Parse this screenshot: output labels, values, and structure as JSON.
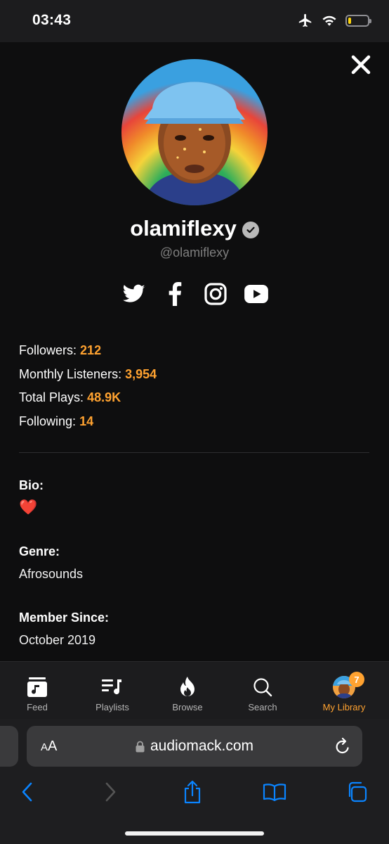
{
  "status_bar": {
    "time": "03:43",
    "icons": [
      "airplane-icon",
      "wifi-icon",
      "battery-icon"
    ],
    "battery_level": 0.15
  },
  "profile": {
    "name": "olamiflexy",
    "handle": "@olamiflexy",
    "verified": true,
    "social_icons": [
      "twitter-icon",
      "facebook-icon",
      "instagram-icon",
      "youtube-icon"
    ]
  },
  "stats": {
    "followers_label": "Followers:",
    "followers_value": "212",
    "monthly_label": "Monthly Listeners:",
    "monthly_value": "3,954",
    "plays_label": "Total Plays:",
    "plays_value": "48.9K",
    "following_label": "Following:",
    "following_value": "14"
  },
  "info": {
    "bio_label": "Bio:",
    "bio_value": "❤️",
    "genre_label": "Genre:",
    "genre_value": "Afrosounds",
    "member_label": "Member Since:",
    "member_value": "October 2019"
  },
  "tabs": [
    {
      "label": "Feed",
      "icon": "feed-icon"
    },
    {
      "label": "Playlists",
      "icon": "playlists-icon"
    },
    {
      "label": "Browse",
      "icon": "flame-icon"
    },
    {
      "label": "Search",
      "icon": "search-icon"
    },
    {
      "label": "My Library",
      "icon": "avatar",
      "badge": "7",
      "active": true
    }
  ],
  "browser": {
    "aa_label_small": "A",
    "aa_label_large": "A",
    "url": "audiomack.com"
  },
  "colors": {
    "accent": "#ffa230",
    "safari_blue": "#0a84ff"
  }
}
